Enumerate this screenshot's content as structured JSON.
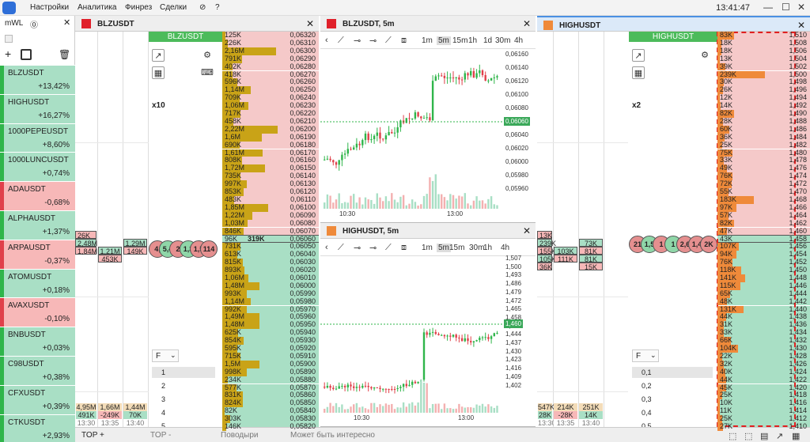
{
  "menu": {
    "items": [
      "Настройки",
      "Аналитика",
      "Финрез",
      "Сделки"
    ],
    "clock": "13:41:47"
  },
  "watchlist": {
    "title": "mWL",
    "items": [
      {
        "symbol": "BLZUSDT",
        "change": "+13,42%",
        "up": true
      },
      {
        "symbol": "HIGHUSDT",
        "change": "+16,27%",
        "up": true
      },
      {
        "symbol": "1000PEPEUSDT",
        "change": "+8,60%",
        "up": true
      },
      {
        "symbol": "1000LUNCUSDT",
        "change": "+0,74%",
        "up": true
      },
      {
        "symbol": "ADAUSDT",
        "change": "-0,68%",
        "up": false
      },
      {
        "symbol": "ALPHAUSDT",
        "change": "+1,37%",
        "up": true
      },
      {
        "symbol": "ARPAUSDT",
        "change": "-0,37%",
        "up": false
      },
      {
        "symbol": "ATOMUSDT",
        "change": "+0,18%",
        "up": true
      },
      {
        "symbol": "AVAXUSDT",
        "change": "-0,10%",
        "up": false
      },
      {
        "symbol": "BNBUSDT",
        "change": "+0,03%",
        "up": true
      },
      {
        "symbol": "C98USDT",
        "change": "+0,38%",
        "up": true
      },
      {
        "symbol": "CFXUSDT",
        "change": "+0,39%",
        "up": true
      },
      {
        "symbol": "CTKUSDT",
        "change": "+2,93%",
        "up": true
      }
    ]
  },
  "blz": {
    "tab": "BLZUSDT",
    "header": "BLZUSDT",
    "mult": "x10",
    "ask_vols": [
      "125K",
      "226K",
      "2,16M",
      "791K",
      "402K",
      "418K",
      "596K",
      "1,14M",
      "709K",
      "1,06M",
      "717K",
      "458K",
      "2,22M",
      "1,6M",
      "690K",
      "1,61M",
      "808K",
      "1,72M",
      "735K",
      "997K",
      "853K",
      "483K",
      "1,85M",
      "1,22M",
      "1,03M",
      "846K"
    ],
    "ask_prices": [
      "0,06320",
      "0,06310",
      "0,06300",
      "0,06290",
      "0,06280",
      "0,06270",
      "0,06260",
      "0,06250",
      "0,06240",
      "0,06230",
      "0,06220",
      "0,06210",
      "0,06200",
      "0,06190",
      "0,06180",
      "0,06170",
      "0,06160",
      "0,06150",
      "0,06140",
      "0,06130",
      "0,06120",
      "0,06110",
      "0,06100",
      "0,06090",
      "0,06080",
      "0,06070"
    ],
    "mid_vol": "96K",
    "mid_vol2": "319K",
    "mid_price": "0,06060",
    "bid_vols": [
      "731K",
      "613K",
      "815K",
      "893K",
      "1,06M",
      "1,48M",
      "993K",
      "1,14M",
      "992K",
      "1,49M",
      "1,48M",
      "625K",
      "854K",
      "595K",
      "715K",
      "1,5M",
      "998K",
      "234K",
      "577K",
      "831K",
      "824K",
      "82K",
      "303K",
      "146K"
    ],
    "bid_prices": [
      "0,06050",
      "0,06040",
      "0,06030",
      "0,06020",
      "0,06010",
      "0,06000",
      "0,05990",
      "0,05980",
      "0,05970",
      "0,05960",
      "0,05950",
      "0,05940",
      "0,05930",
      "0,05920",
      "0,05910",
      "0,05900",
      "0,05890",
      "0,05880",
      "0,05870",
      "0,05860",
      "0,05850",
      "0,05840",
      "0,05830",
      "0,05820"
    ],
    "trades_left": [
      "26K",
      "2,48M",
      "1,84M"
    ],
    "trades_mid": [
      "1,21M",
      "453K"
    ],
    "trades_mid2": [
      "1,29M",
      "149K"
    ],
    "bottom_left": [
      "4,95M",
      "491K",
      "13:30"
    ],
    "bottom_mid": [
      "1,66M",
      "-249K",
      "13:35"
    ],
    "bottom_mid2": [
      "1,44M",
      "70K",
      "13:40"
    ],
    "bubbles": [
      "4,",
      "5,4",
      "2",
      "1,3",
      "1,5",
      "114"
    ],
    "levels_label": "F",
    "levels": [
      "1",
      "2",
      "3",
      "4",
      "5"
    ]
  },
  "chart1": {
    "title": "BLZUSDT, 5m",
    "tfs": [
      "1m",
      "5m",
      "15m",
      "1h",
      "1d",
      "30m",
      "4h"
    ],
    "yticks": [
      "0,06160",
      "0,06140",
      "0,06120",
      "0,06100",
      "0,06080",
      "0,06060",
      "0,06040",
      "0,06020",
      "0,06000",
      "0,05980",
      "0,05960"
    ],
    "xticks": [
      "10:30",
      "13:00"
    ],
    "last": "0,06060"
  },
  "chart2": {
    "title": "HIGHUSDT, 5m",
    "tfs": [
      "1m",
      "5m",
      "15m",
      "30m",
      "1h",
      "4h"
    ],
    "yticks": [
      "1,507",
      "1,500",
      "1,493",
      "1,486",
      "1,479",
      "1,472",
      "1,465",
      "1,458",
      "1,451",
      "1,444",
      "1,437",
      "1,430",
      "1,423",
      "1,416",
      "1,409",
      "1,402"
    ],
    "xticks": [
      "10:30",
      "13:00"
    ],
    "last": "1,460"
  },
  "high": {
    "tab": "HIGHUSDT",
    "header": "HIGHUSDT",
    "mult": "x2",
    "ask_vols": [
      "83K",
      "18K",
      "18K",
      "13K",
      "39K",
      "239K",
      "30K",
      "26K",
      "12K",
      "14K",
      "82K",
      "28K",
      "60K",
      "36K",
      "25K",
      "75K",
      "33K",
      "49K",
      "76K",
      "72K",
      "55K",
      "183K",
      "97K",
      "57K",
      "82K",
      "47K"
    ],
    "ask_prices": [
      "1,510",
      "1,508",
      "1,506",
      "1,504",
      "1,502",
      "1,500",
      "1,498",
      "1,496",
      "1,494",
      "1,492",
      "1,490",
      "1,488",
      "1,486",
      "1,484",
      "1,482",
      "1,480",
      "1,478",
      "1,476",
      "1,474",
      "1,472",
      "1,470",
      "1,468",
      "1,466",
      "1,464",
      "1,462",
      "1,460"
    ],
    "mid_vol": "43K",
    "mid_price": "1,458",
    "bid_vols": [
      "107K",
      "94K",
      "76K",
      "118K",
      "141K",
      "115K",
      "65K",
      "48K",
      "131K",
      "44K",
      "31K",
      "33K",
      "66K",
      "104K",
      "22K",
      "32K",
      "40K",
      "44K",
      "45K",
      "25K",
      "10K",
      "11K",
      "25K",
      "27K"
    ],
    "bid_prices": [
      "1,456",
      "1,454",
      "1,452",
      "1,450",
      "1,448",
      "1,446",
      "1,444",
      "1,442",
      "1,440",
      "1,438",
      "1,436",
      "1,434",
      "1,432",
      "1,430",
      "1,428",
      "1,426",
      "1,424",
      "1,422",
      "1,420",
      "1,418",
      "1,416",
      "1,414",
      "1,412",
      "1,410"
    ],
    "trades_left": [
      "13K",
      "239K",
      "155K",
      "105K",
      "36K"
    ],
    "trades_mid": [
      "103K",
      "111K"
    ],
    "trades_mid2": [
      "73K",
      "81K",
      "81K",
      "15K"
    ],
    "bottom_left": [
      "547K",
      "28K",
      "13:30"
    ],
    "bottom_mid": [
      "214K",
      "-28K",
      "13:35"
    ],
    "bottom_mid2": [
      "251K",
      "14K",
      "13:40"
    ],
    "bubbles": [
      "21",
      "1,5",
      "1",
      "1",
      "2,6",
      "1,4",
      "2K"
    ],
    "levels_label": "F",
    "levels": [
      "0,1",
      "0,2",
      "0,3",
      "0,4",
      "0,5"
    ]
  },
  "bottombar": {
    "tabs": [
      "TOP +",
      "TOP -",
      "Поводыри",
      "Может быть интересно"
    ]
  },
  "colors": {
    "green": "#4cbb5b",
    "red": "#e0404a",
    "askbg": "#f5c9c9",
    "bidbg": "#a9dfc5",
    "gold": "#c9a317",
    "orange": "#ef8a3a"
  }
}
